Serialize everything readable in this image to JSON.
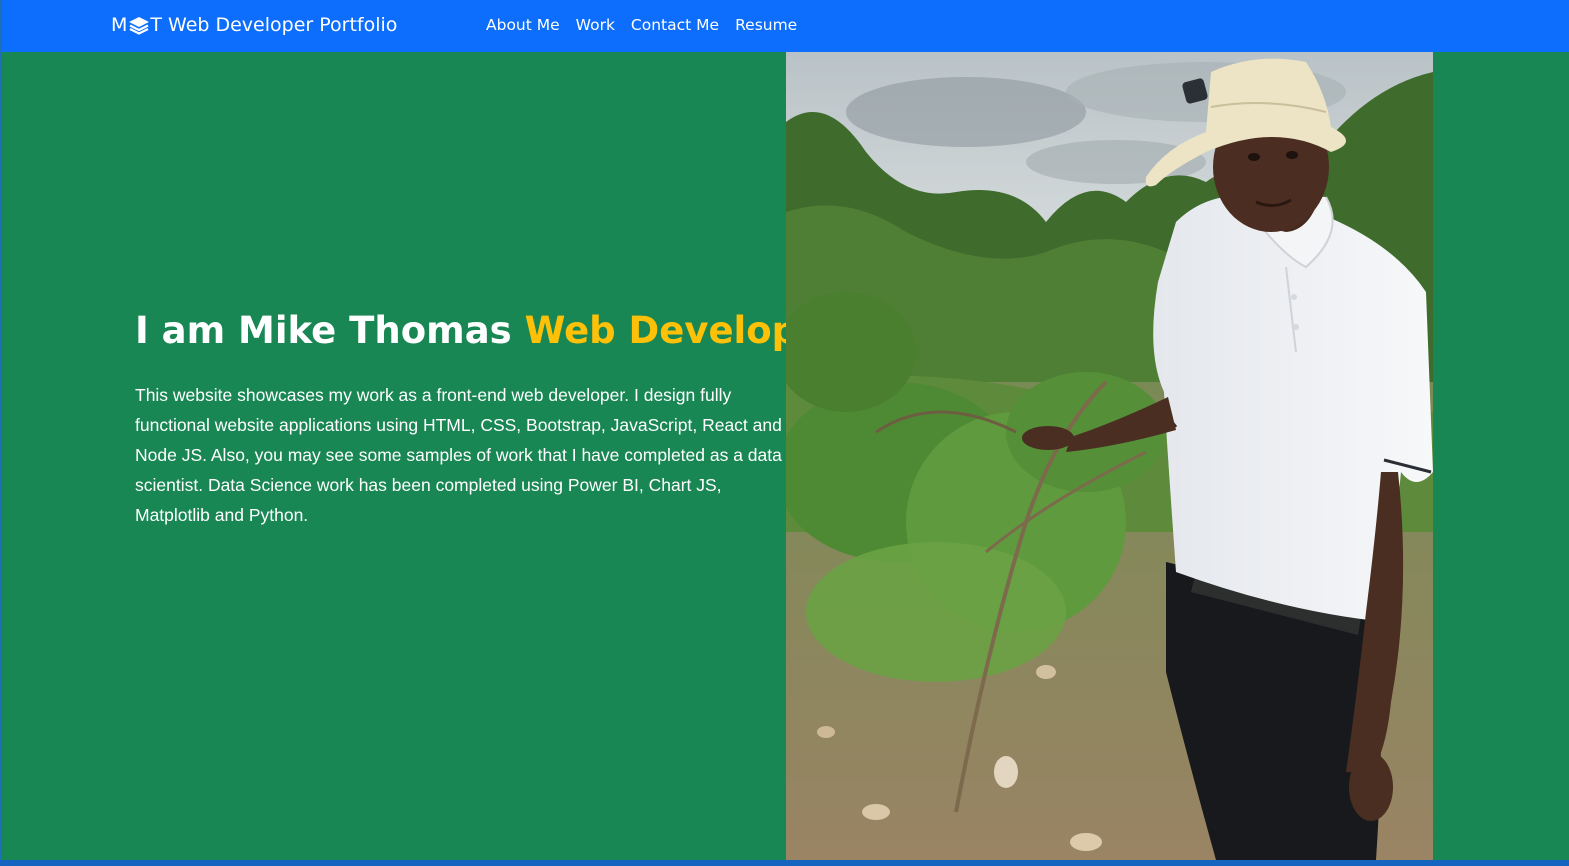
{
  "navbar": {
    "brand_initial_1": "M",
    "brand_initial_2": "T",
    "brand_logo_icon": "layers-icon",
    "brand_text": "Web Developer Portfolio",
    "links": [
      {
        "label": "About Me"
      },
      {
        "label": "Work"
      },
      {
        "label": "Contact Me"
      },
      {
        "label": "Resume"
      }
    ],
    "background_color": "#0d6efd"
  },
  "hero": {
    "title_prefix": "I am Mike Thomas",
    "title_highlight": "Web Developer",
    "description": "This website showcases my work as a front-end web developer. I design fully functional website applications using HTML, CSS, Bootstrap, JavaScript, React and Node JS. Also, you may see some samples of work that I have completed as a data scientist. Data Science work has been completed using Power BI, Chart JS, Matplotlib and Python.",
    "background_color": "#198754",
    "highlight_color": "#ffc107"
  },
  "photo": {
    "subject": "profile-photo"
  }
}
